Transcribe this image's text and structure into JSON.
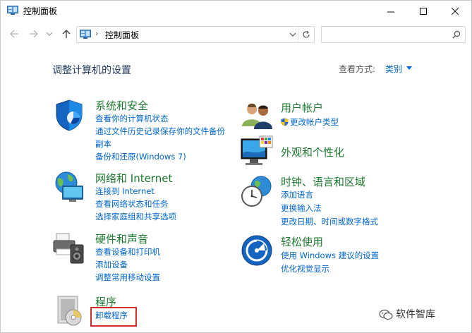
{
  "window": {
    "title": "控制面板"
  },
  "address": {
    "path": "控制面板",
    "separator": "›",
    "search_placeholder": ""
  },
  "main": {
    "heading": "调整计算机的设置",
    "view_by_label": "查看方式:",
    "view_by_value": "类别"
  },
  "categories": [
    {
      "title": "系统和安全",
      "links": [
        "查看你的计算机状态",
        "通过文件历史记录保存你的文件备份",
        "副本",
        "备份和还原(Windows 7)"
      ]
    },
    {
      "title": "网络和 Internet",
      "links": [
        "连接到 Internet",
        "查看网络状态和任务",
        "选择家庭组和共享选项"
      ]
    },
    {
      "title": "硬件和声音",
      "links": [
        "查看设备和打印机",
        "添加设备",
        "调整常用移动设置"
      ]
    },
    {
      "title": "程序",
      "links": [
        "卸载程序"
      ]
    },
    {
      "title": "用户帐户",
      "links": [
        "更改帐户类型"
      ]
    },
    {
      "title": "外观和个性化",
      "links": []
    },
    {
      "title": "时钟、语言和区域",
      "links": [
        "添加语言",
        "更换输入法",
        "更改日期、时间或数字格式"
      ]
    },
    {
      "title": "轻松使用",
      "links": [
        "使用 Windows 建议的设置",
        "优化视觉显示"
      ]
    }
  ],
  "watermark": "软件智库",
  "colors": {
    "category_title": "#1e7a30",
    "link": "#0066cc",
    "highlight": "#d42a2a"
  }
}
